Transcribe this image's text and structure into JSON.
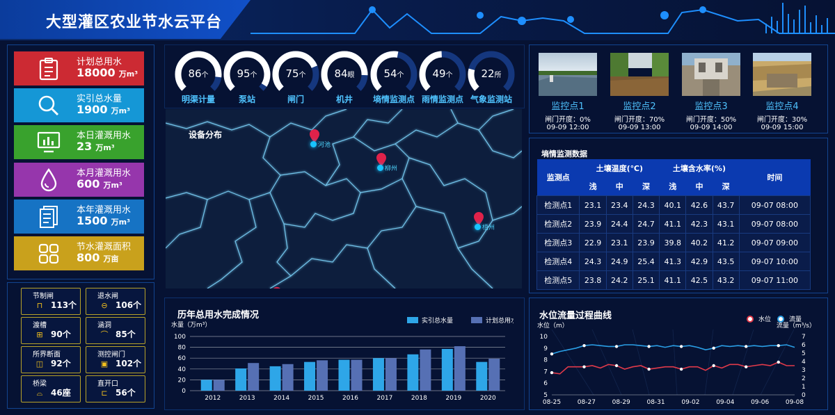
{
  "header": {
    "title": "大型灌区农业节水云平台"
  },
  "stats": [
    {
      "label": "计划总用水",
      "value": "18000",
      "unit": "万m³",
      "color": "#cc2a33",
      "icon": "clipboard-icon"
    },
    {
      "label": "实引总水量",
      "value": "1900",
      "unit": "万m³",
      "color": "#1597d6",
      "icon": "search-icon"
    },
    {
      "label": "本日灌溉用水",
      "value": "23",
      "unit": "万m³",
      "color": "#39a22d",
      "icon": "monitor-chart-icon"
    },
    {
      "label": "本月灌溉用水",
      "value": "600",
      "unit": "万m³",
      "color": "#9636ac",
      "icon": "water-drop-icon"
    },
    {
      "label": "本年灌溉用水",
      "value": "1500",
      "unit": "万m³",
      "color": "#1673c4",
      "icon": "document-icon"
    },
    {
      "label": "节水灌溉面积",
      "value": "800",
      "unit": "万亩",
      "color": "#c9a11c",
      "icon": "grid-icon"
    }
  ],
  "facilities": [
    {
      "label": "节制闸",
      "value": "113个",
      "icon": "gate-icon"
    },
    {
      "label": "退水闸",
      "value": "106个",
      "icon": "minus-circle-icon"
    },
    {
      "label": "渡槽",
      "value": "90个",
      "icon": "aqueduct-icon"
    },
    {
      "label": "涵洞",
      "value": "85个",
      "icon": "culvert-icon"
    },
    {
      "label": "所界断面",
      "value": "92个",
      "icon": "section-icon"
    },
    {
      "label": "测控闸门",
      "value": "102个",
      "icon": "control-gate-icon"
    },
    {
      "label": "桥梁",
      "value": "46座",
      "icon": "bridge-icon"
    },
    {
      "label": "直开口",
      "value": "56个",
      "icon": "opening-icon"
    }
  ],
  "gauges": [
    {
      "value": "86",
      "unit": "个",
      "label": "明渠计量",
      "fill": 0.86
    },
    {
      "value": "95",
      "unit": "个",
      "label": "泵站",
      "fill": 0.95
    },
    {
      "value": "75",
      "unit": "个",
      "label": "闸门",
      "fill": 0.75
    },
    {
      "value": "84",
      "unit": "眼",
      "label": "机井",
      "fill": 0.84
    },
    {
      "value": "54",
      "unit": "个",
      "label": "墒情监测点",
      "fill": 0.54
    },
    {
      "value": "49",
      "unit": "个",
      "label": "雨情监测点",
      "fill": 0.49
    },
    {
      "value": "22",
      "unit": "所",
      "label": "气象监测站",
      "fill": 0.22
    }
  ],
  "map": {
    "title": "设备分布",
    "markers": [
      "河池",
      "柳州",
      "梧州"
    ]
  },
  "cameras": [
    {
      "name": "监控点1",
      "gate": "闸门开度：0%",
      "time": "09-09 12:00"
    },
    {
      "name": "监控点2",
      "gate": "闸门开度：70%",
      "time": "09-09 13:00"
    },
    {
      "name": "监控点3",
      "gate": "闸门开度：50%",
      "time": "09-09 14:00"
    },
    {
      "name": "监控点4",
      "gate": "闸门开度：30%",
      "time": "09-09 15:00"
    }
  ],
  "soil": {
    "title": "墒情监测数据",
    "headers": {
      "point": "监测点",
      "temp": "土壤温度(℃)",
      "moisture": "土壤含水率(%)",
      "time": "时间",
      "shallow": "浅",
      "mid": "中",
      "deep": "深"
    },
    "rows": [
      [
        "检测点1",
        "23.1",
        "23.4",
        "24.3",
        "40.1",
        "42.6",
        "43.7",
        "09-07 08:00"
      ],
      [
        "检测点2",
        "23.9",
        "24.4",
        "24.7",
        "41.1",
        "42.3",
        "43.1",
        "09-07 08:00"
      ],
      [
        "检测点3",
        "22.9",
        "23.1",
        "23.9",
        "39.8",
        "40.2",
        "41.2",
        "09-07 09:00"
      ],
      [
        "检测点4",
        "24.3",
        "24.9",
        "25.4",
        "41.3",
        "42.9",
        "43.5",
        "09-07 10:00"
      ],
      [
        "检测点5",
        "23.8",
        "24.2",
        "25.1",
        "41.1",
        "42.5",
        "43.2",
        "09-07 11:00"
      ]
    ]
  },
  "bar_panel": {
    "title": "历年总用水完成情况"
  },
  "line_panel": {
    "title": "水位流量过程曲线"
  },
  "chart_data": [
    {
      "type": "bar",
      "title": "历年总用水完成情况",
      "ylabel": "水量（万m³）",
      "categories": [
        "2012",
        "2013",
        "2014",
        "2015",
        "2016",
        "2017",
        "2018",
        "2019",
        "2020"
      ],
      "series": [
        {
          "name": "实引总水量",
          "values": [
            20,
            41,
            45,
            53,
            57,
            60,
            67,
            77,
            53
          ],
          "color": "#2ea6e8"
        },
        {
          "name": "计划总用水",
          "values": [
            20,
            51,
            49,
            56,
            57,
            60,
            76,
            82,
            59
          ],
          "color": "#5670b4"
        }
      ],
      "ylim": [
        0,
        100
      ],
      "yticks": [
        "0",
        "20",
        "40",
        "60",
        "80",
        "100"
      ],
      "grid": true,
      "legend": "top-right"
    },
    {
      "type": "line",
      "title": "水位流量过程曲线",
      "x": [
        "08-25",
        "08-27",
        "08-29",
        "08-31",
        "09-02",
        "09-04",
        "09-06",
        "09-08"
      ],
      "ylabel_left": "水位（m）",
      "ylabel_right": "流量（m³/s）",
      "yticks_left": [
        "5",
        "6",
        "7",
        "8",
        "9",
        "10"
      ],
      "yticks_right": [
        "0",
        "1",
        "2",
        "3",
        "4",
        "5",
        "6",
        "7"
      ],
      "ylim_left": [
        5,
        10
      ],
      "ylim_right": [
        0,
        7
      ],
      "series": [
        {
          "name": "水位",
          "axis": "left",
          "color": "#e23a4a",
          "values": [
            6.9,
            6.8,
            7.4,
            7.4,
            7.4,
            7.5,
            7.3,
            7.6,
            7.5,
            7.2,
            7.4,
            7.5,
            7.2,
            7.3,
            7.4,
            7.4,
            7.2,
            7.4,
            7.4,
            7.1,
            7.5,
            7.3,
            7.6,
            7.6,
            7.4,
            7.5,
            7.6,
            7.5,
            7.8,
            7.5,
            7.5
          ]
        },
        {
          "name": "流量",
          "axis": "right",
          "color": "#2a9fe6",
          "values": [
            4.9,
            5.2,
            5.4,
            5.6,
            5.9,
            6.0,
            5.9,
            5.8,
            5.8,
            6.0,
            6.0,
            5.9,
            5.8,
            5.9,
            5.7,
            5.9,
            5.8,
            5.9,
            5.7,
            5.4,
            5.6,
            5.9,
            5.8,
            5.9,
            5.8,
            5.9,
            5.8,
            5.9,
            5.9,
            6.0,
            5.7
          ]
        }
      ],
      "legend": "top-right"
    }
  ]
}
